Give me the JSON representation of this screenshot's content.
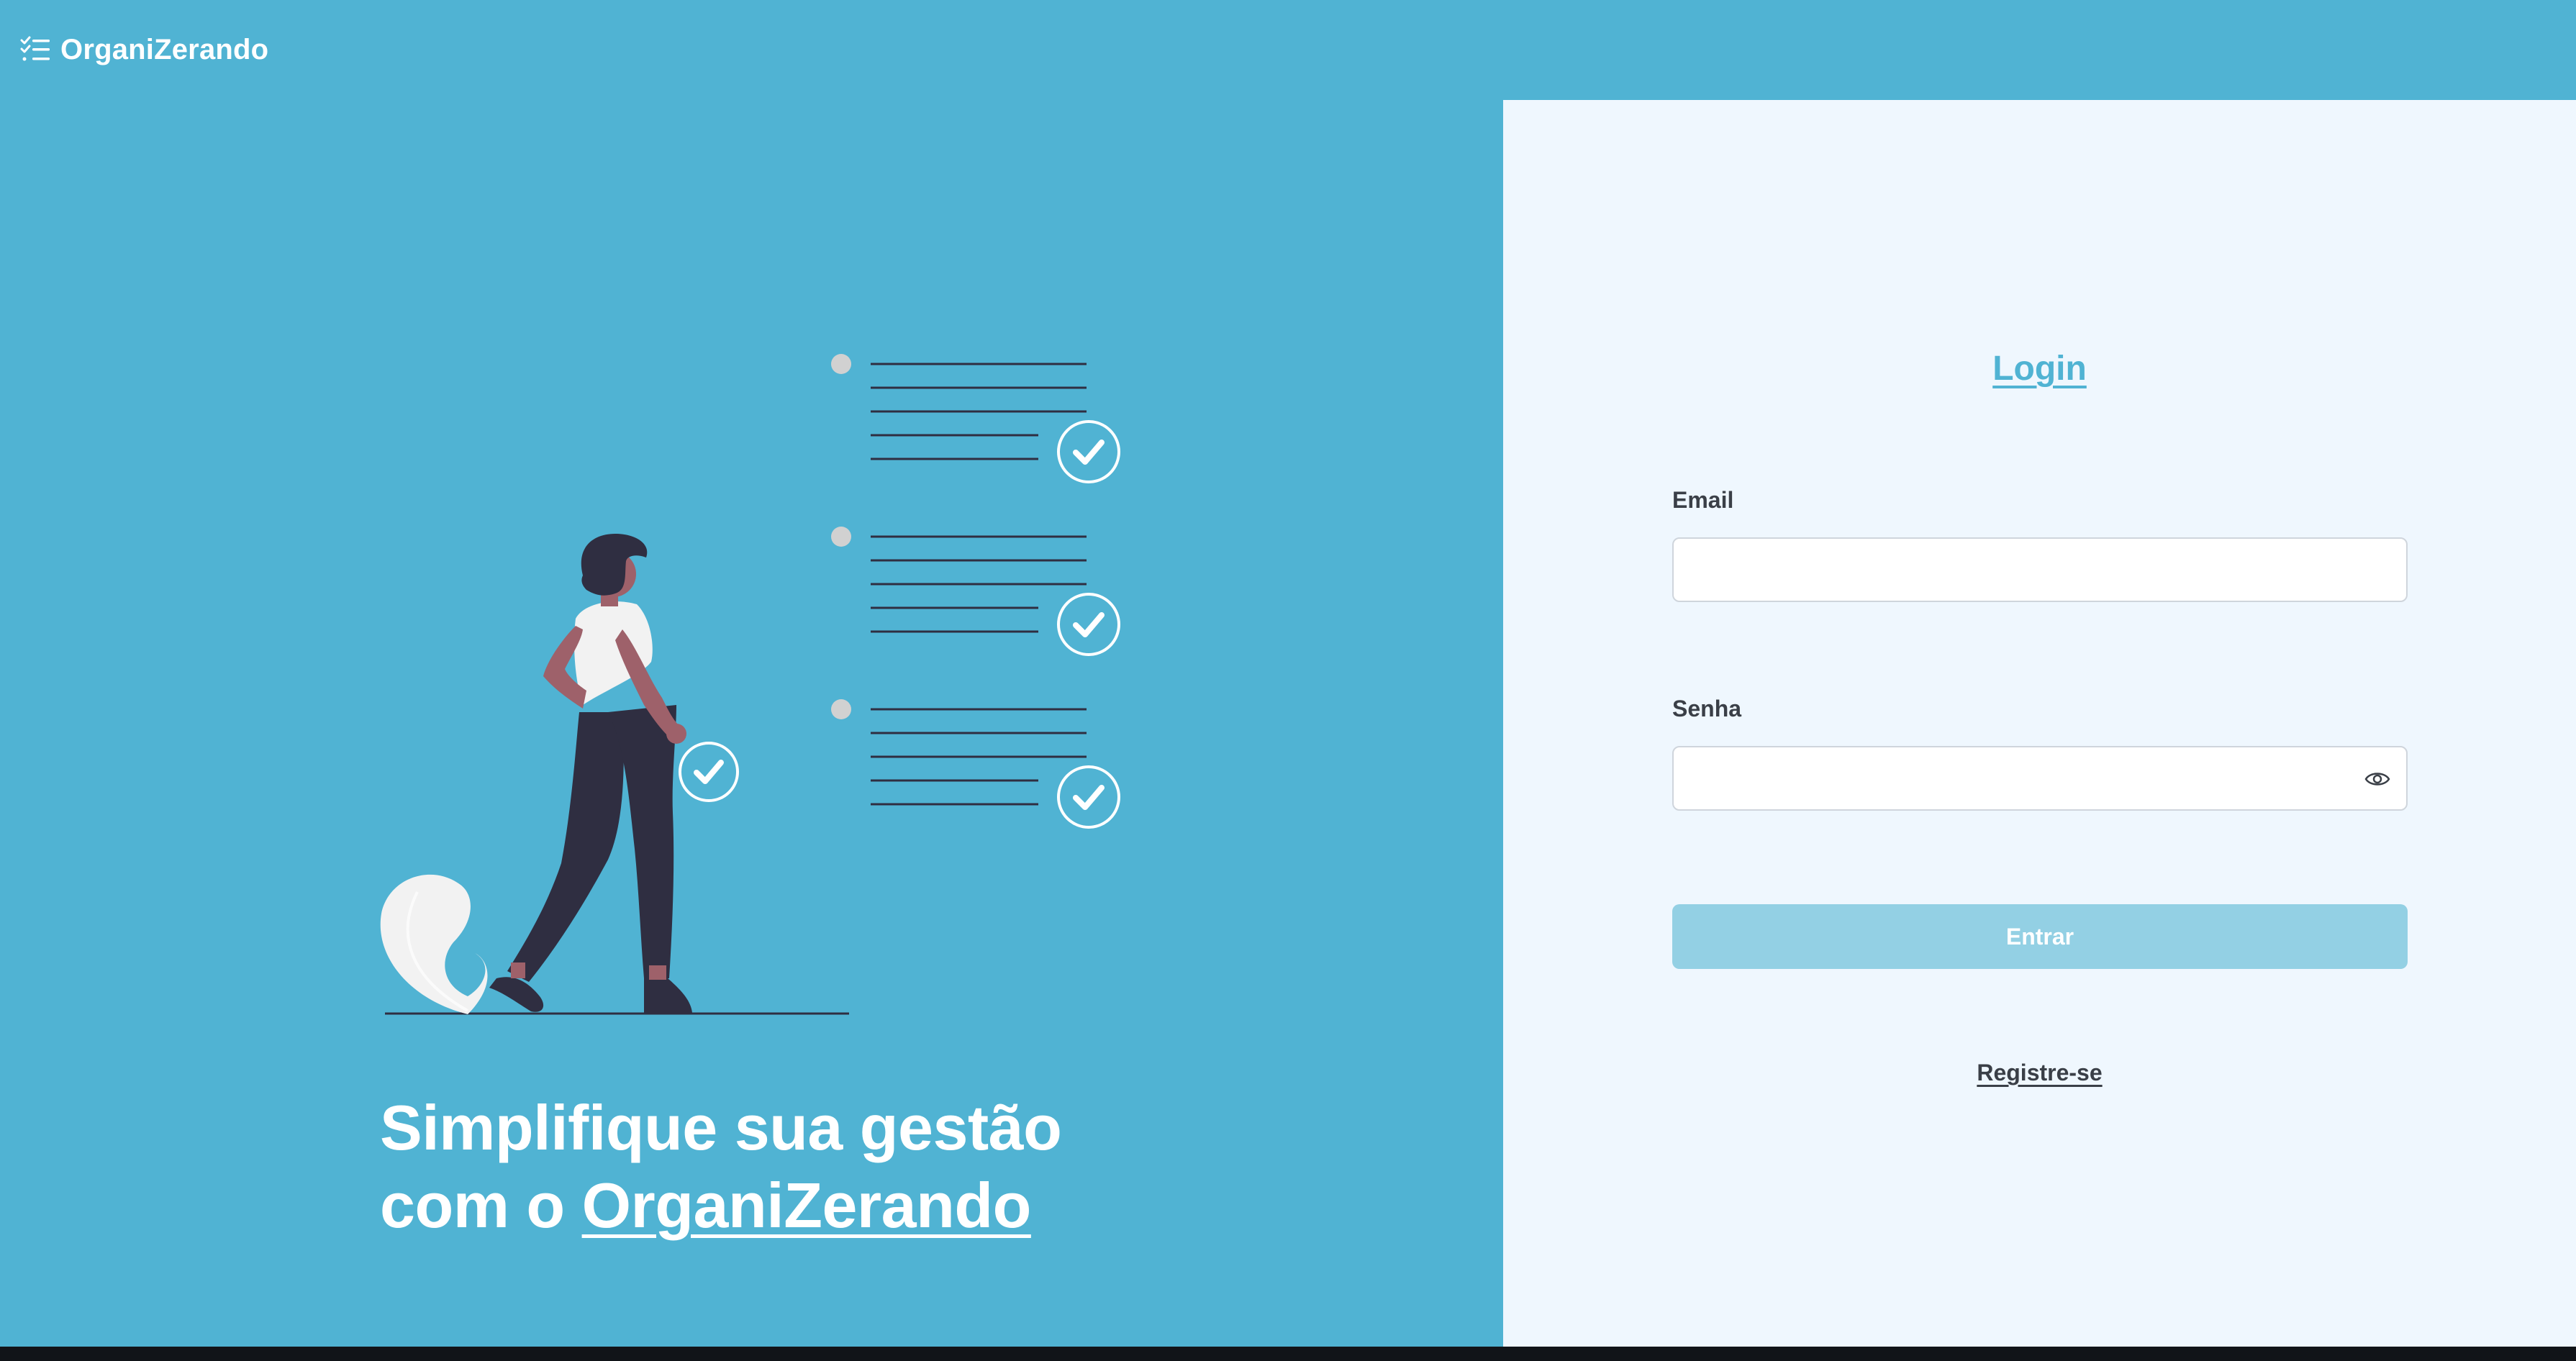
{
  "app": {
    "name": "OrganiZerando",
    "logo_icon": "checklist-icon"
  },
  "hero": {
    "headline_line1": "Simplifique sua gestão",
    "headline_line2_prefix": "com o ",
    "headline_line2_brand": "OrganiZerando",
    "illustration": "person-checklist-illustration"
  },
  "login": {
    "title": "Login",
    "email_label": "Email",
    "email_value": "",
    "email_placeholder": "",
    "password_label": "Senha",
    "password_value": "",
    "password_placeholder": "",
    "show_password_icon": "eye-icon",
    "submit_label": "Entrar",
    "register_label": "Registre-se"
  },
  "colors": {
    "background": "#50b3d3",
    "panel": "#eff7fe",
    "accent": "#50b3d3",
    "button_disabled": "#93d0e4",
    "text_dark": "#3a3f47"
  }
}
